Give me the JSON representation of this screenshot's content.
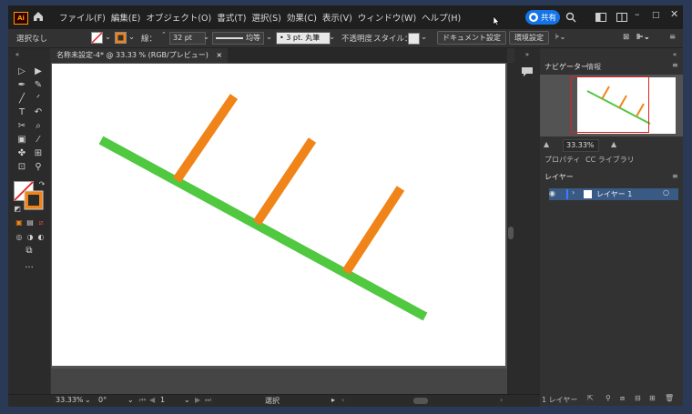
{
  "app": {
    "logo": "Ai"
  },
  "menu": [
    "ファイル(F)",
    "編集(E)",
    "オブジェクト(O)",
    "書式(T)",
    "選択(S)",
    "効果(C)",
    "表示(V)",
    "ウィンドウ(W)",
    "ヘルプ(H)"
  ],
  "share_label": "共有",
  "control": {
    "selection": "選択なし",
    "stroke_label": "線：",
    "stroke_value": "32 pt",
    "profile": "均等",
    "brush": "3 pt. 丸筆",
    "opacity_label": "不透明度",
    "style_label": "スタイル：",
    "doc_setup": "ドキュメント設定",
    "prefs": "環境設定"
  },
  "document_tab": {
    "title": "名称未設定-4* @ 33.33 % (RGB/プレビュー)",
    "close": "×"
  },
  "navigator": {
    "tab_navigator": "ナビゲーター",
    "tab_info": "情報",
    "zoom": "33.33%"
  },
  "properties_tabs": {
    "properties": "プロパティ",
    "libraries": "CC ライブラリ"
  },
  "layers": {
    "tab": "レイヤー",
    "layer_name": "レイヤー 1",
    "count": "1 レイヤー"
  },
  "status": {
    "zoom": "33.33%",
    "rotation": "0°",
    "artboard": "1",
    "tool": "選択"
  },
  "colors": {
    "green": "#50c840",
    "orange": "#f08418",
    "accent": "#1473e6"
  },
  "drawing": {
    "main_line": {
      "color": "green"
    },
    "ticks": {
      "color": "orange",
      "count": 3
    }
  }
}
